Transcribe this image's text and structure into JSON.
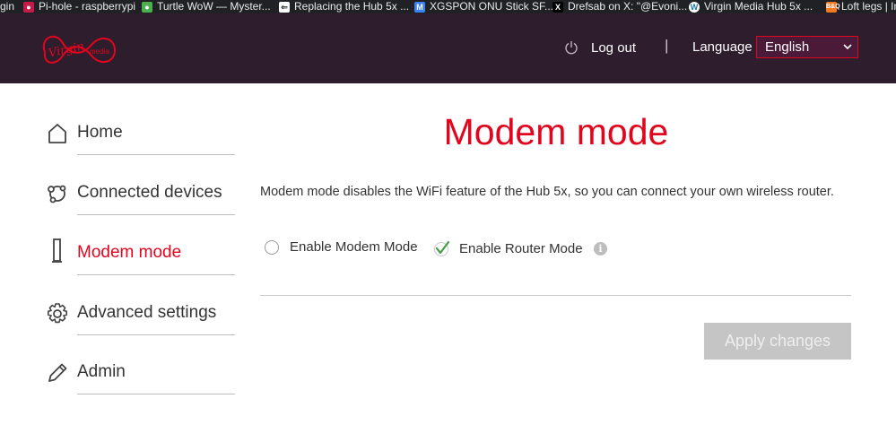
{
  "bookmarks": [
    {
      "label": "gin",
      "icon": "none",
      "color": "#202124"
    },
    {
      "label": "Pi-hole - raspberrypi",
      "icon": "raspberry-icon",
      "color": "#c51a4a"
    },
    {
      "label": "Turtle WoW — Myster...",
      "icon": "turtle-icon",
      "color": "#4caf50"
    },
    {
      "label": "Replacing the Hub 5x ...",
      "icon": "site-icon",
      "color": "#ffffff"
    },
    {
      "label": "XGSPON ONU Stick SF...",
      "icon": "site-icon",
      "color": "#3b82f6"
    },
    {
      "label": "Drefsab on X: \"@Evoni...",
      "icon": "x-icon",
      "color": "#000000"
    },
    {
      "label": "Virgin Media Hub 5x ...",
      "icon": "wordpress-icon",
      "color": "#ffffff"
    },
    {
      "label": "Loft legs | In",
      "icon": "bq-icon",
      "color": "#f47920"
    }
  ],
  "header": {
    "brand": "Virgin media",
    "logout_label": "Log out",
    "separator": "|",
    "language_label": "Language",
    "language_value": "English"
  },
  "nav": [
    {
      "label": "Home",
      "icon": "home-icon",
      "active": false
    },
    {
      "label": "Connected devices",
      "icon": "connected-devices-icon",
      "active": false
    },
    {
      "label": "Modem mode",
      "icon": "modem-icon",
      "active": true
    },
    {
      "label": "Advanced settings",
      "icon": "gear-icon",
      "active": false
    },
    {
      "label": "Admin",
      "icon": "pencil-icon",
      "active": false
    }
  ],
  "main": {
    "title": "Modem mode",
    "description": "Modem mode disables the WiFi feature of the Hub 5x, so you can connect your own wireless router.",
    "options": [
      {
        "label": "Enable Modem Mode",
        "selected": false
      },
      {
        "label": "Enable Router Mode",
        "selected": true
      }
    ],
    "info_glyph": "i",
    "apply_label": "Apply changes"
  },
  "colors": {
    "accent": "#e1051e",
    "header_bg": "#2e1d2d",
    "disabled_button": "#c5c5c5"
  }
}
